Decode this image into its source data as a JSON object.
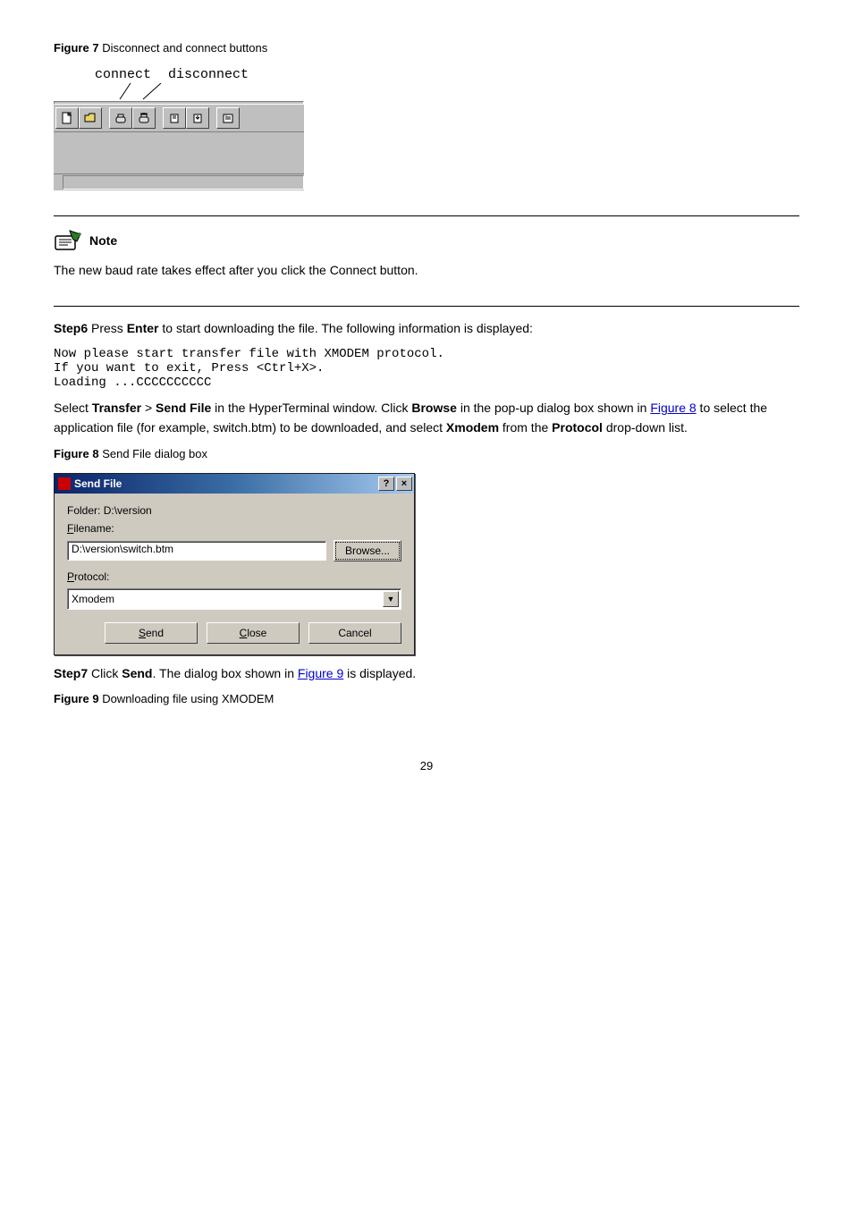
{
  "figure7": {
    "label_prefix": "Figure 7",
    "label_rest": " Disconnect and connect buttons",
    "connect_label": "connect",
    "disconnect_label": "disconnect"
  },
  "note": {
    "heading": "Note",
    "text": "The new baud rate takes effect after you click the Connect button."
  },
  "step6": {
    "lead": "Step6",
    "sentence_a": " Press ",
    "key": "Enter",
    "sentence_b": " to start downloading the file. The following information is displayed:",
    "line1": "Now please start transfer file with XMODEM protocol.",
    "line2": "If you want to exit, Press <Ctrl+X>.",
    "line3": "Loading ...CCCCCCCCCC"
  },
  "sendfile_intro_a": "Select ",
  "sendfile_intro_b": "Transfer",
  "sendfile_intro_c": " > ",
  "sendfile_intro_d": "Send File",
  "sendfile_intro_e": " in the HyperTerminal window. Click ",
  "sendfile_intro_f": "Browse",
  "sendfile_intro_g": " in the pop-up dialog box shown in ",
  "sendfile_intro_link": "Figure 8",
  "sendfile_intro_h": " to select the application file (for example, switch.btm) to be downloaded, and select ",
  "sendfile_intro_i": "Xmodem",
  "sendfile_intro_j": " from the ",
  "sendfile_intro_k": "Protocol",
  "sendfile_intro_l": " drop-down list.",
  "figure8": {
    "label_prefix": "Figure 8",
    "label_rest": " Send File dialog box",
    "title": "Send File",
    "folder_label": "Folder: ",
    "folder_value": "D:\\version",
    "filename_label_pre": "F",
    "filename_label_post": "ilename:",
    "filename_value": "D:\\version\\switch.btm",
    "browse_pre": "B",
    "browse_post": "rowse...",
    "protocol_label_pre": "P",
    "protocol_label_post": "rotocol:",
    "protocol_value": "Xmodem",
    "send_pre": "S",
    "send_post": "end",
    "close_pre": "C",
    "close_post": "lose",
    "cancel": "Cancel"
  },
  "step7": {
    "lead": "Step7",
    "sentence_a": " Click ",
    "btn": "Send",
    "sentence_b": ". The dialog box shown in ",
    "link": "Figure 9",
    "sentence_c": " is displayed."
  },
  "figure9": {
    "label_prefix": "Figure 9",
    "label_rest": " Downloading file using XMODEM"
  },
  "page_number": "29"
}
